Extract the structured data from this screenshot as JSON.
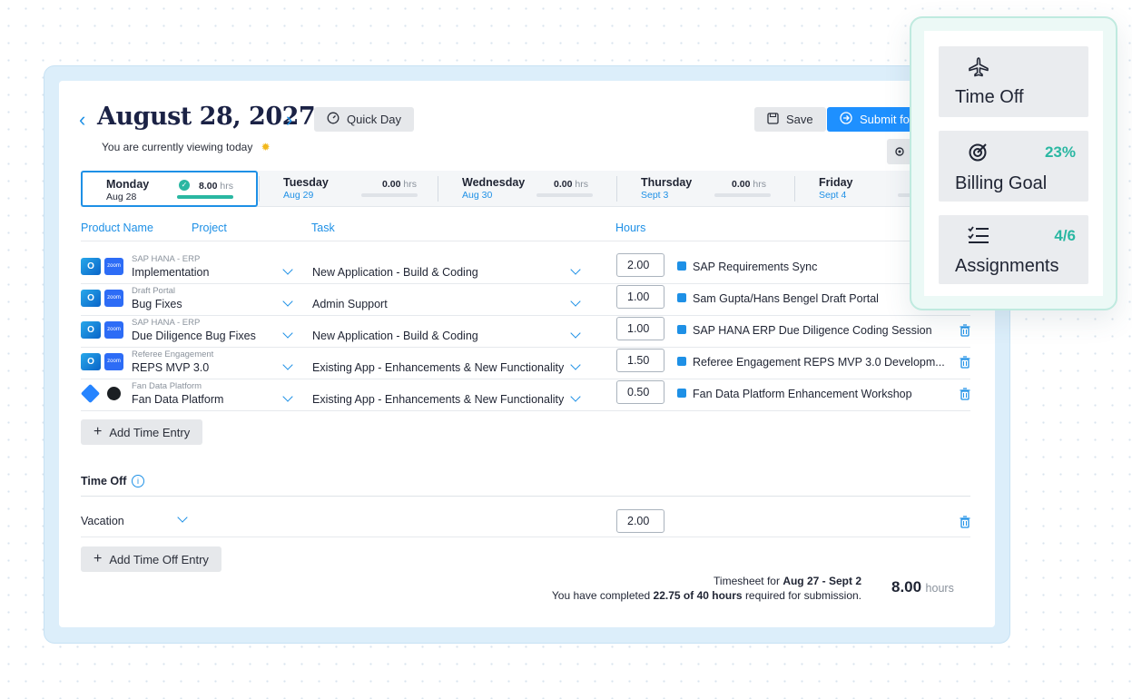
{
  "header": {
    "date": "August 28, 2027",
    "subtitle": "You are currently viewing today",
    "quick_day": "Quick Day",
    "save": "Save",
    "submit": "Submit for"
  },
  "days": [
    {
      "name": "Monday",
      "date": "Aug 28",
      "hours": "8.00",
      "unit": "hrs",
      "progress": 1.0,
      "active": true
    },
    {
      "name": "Tuesday",
      "date": "Aug 29",
      "hours": "0.00",
      "unit": "hrs",
      "progress": 0.0
    },
    {
      "name": "Wednesday",
      "date": "Aug 30",
      "hours": "0.00",
      "unit": "hrs",
      "progress": 0.0
    },
    {
      "name": "Thursday",
      "date": "Sept 3",
      "hours": "0.00",
      "unit": "hrs",
      "progress": 0.0
    },
    {
      "name": "Friday",
      "date": "Sept 4",
      "hours": "",
      "unit": "",
      "progress": 0.0
    }
  ],
  "columns": {
    "product": "Product Name",
    "project": "Project",
    "task": "Task",
    "hours": "Hours"
  },
  "entries": [
    {
      "product": "SAP HANA - ERP",
      "project": "Implementation",
      "task": "New Application - Build & Coding",
      "hours": "2.00",
      "note": "SAP Requirements Sync",
      "icons": "o-zoom"
    },
    {
      "product": "Draft Portal",
      "project": "Bug Fixes",
      "task": "Admin Support",
      "hours": "1.00",
      "note": "Sam Gupta/Hans Bengel Draft Portal",
      "icons": "o-zoom"
    },
    {
      "product": "SAP HANA - ERP",
      "project": "Due Diligence Bug Fixes",
      "task": "New Application - Build & Coding",
      "hours": "1.00",
      "note": "SAP HANA ERP Due Diligence Coding Session",
      "icons": "o-zoom"
    },
    {
      "product": "Referee Engagement",
      "project": "REPS MVP 3.0",
      "task": "Existing App - Enhancements & New Functionality",
      "hours": "1.50",
      "note": "Referee Engagement REPS MVP 3.0 Developm...",
      "icons": "o-zoom"
    },
    {
      "product": "Fan Data Platform",
      "project": "Fan Data Platform",
      "task": "Existing App - Enhancements & New Functionality",
      "hours": "0.50",
      "note": "Fan Data Platform Enhancement Workshop",
      "icons": "jira-github"
    }
  ],
  "add_time_entry": "Add Time Entry",
  "time_off": {
    "title": "Time Off",
    "type": "Vacation",
    "hours": "2.00",
    "add_label": "Add Time Off Entry"
  },
  "footer": {
    "timesheet_prefix": "Timesheet for",
    "timesheet_range": "Aug 27 - Sept 2",
    "completed_prefix": "You have completed",
    "completed_value": "22.75 of 40 hours",
    "completed_suffix": "required for submission.",
    "total": "8.00",
    "total_unit": "hours"
  },
  "panel": {
    "time_off": "Time Off",
    "billing_goal": "Billing Goal",
    "billing_pct": "23%",
    "assignments": "Assignments",
    "assignments_count": "4/6"
  },
  "colors": {
    "accent": "#1e90e6",
    "teal": "#2ab7a2",
    "title": "#1b2245"
  }
}
